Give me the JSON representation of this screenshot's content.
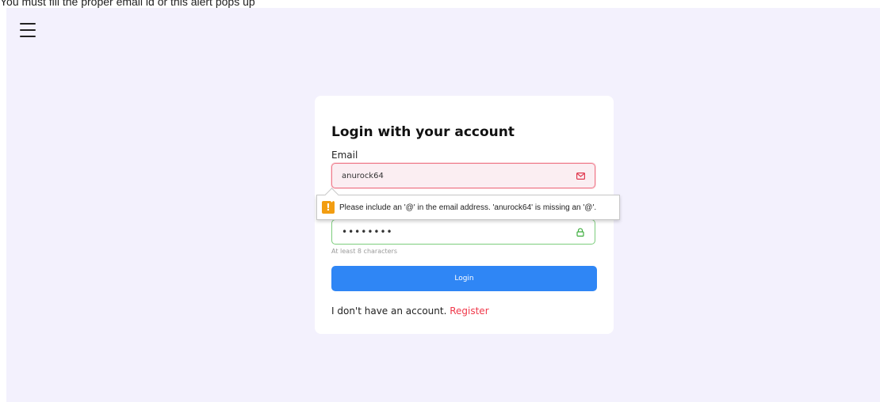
{
  "caption": "You must fill the proper email id or this alert pops up",
  "header": {
    "menu_icon": "hamburger-menu-icon"
  },
  "login_card": {
    "title": "Login with your account",
    "email_label": "Email",
    "email_value": "anurock64",
    "email_icon": "mail-icon",
    "password_value": "••••••••",
    "password_icon": "lock-icon",
    "password_hint": "At least 8 characters",
    "login_button": "Login",
    "register_prompt": "I don't have an account.",
    "register_link": "Register"
  },
  "validation_tooltip": {
    "icon": "warning-icon",
    "icon_glyph": "!",
    "message": "Please include an '@' in the email address. 'anurock64' is missing an '@'."
  },
  "colors": {
    "background": "#f3f1fd",
    "primary_button": "#2f86f5",
    "error_border": "#ef7c8c",
    "success_border": "#7ccd7c",
    "link": "#f0394b",
    "warning": "#f29d11"
  }
}
